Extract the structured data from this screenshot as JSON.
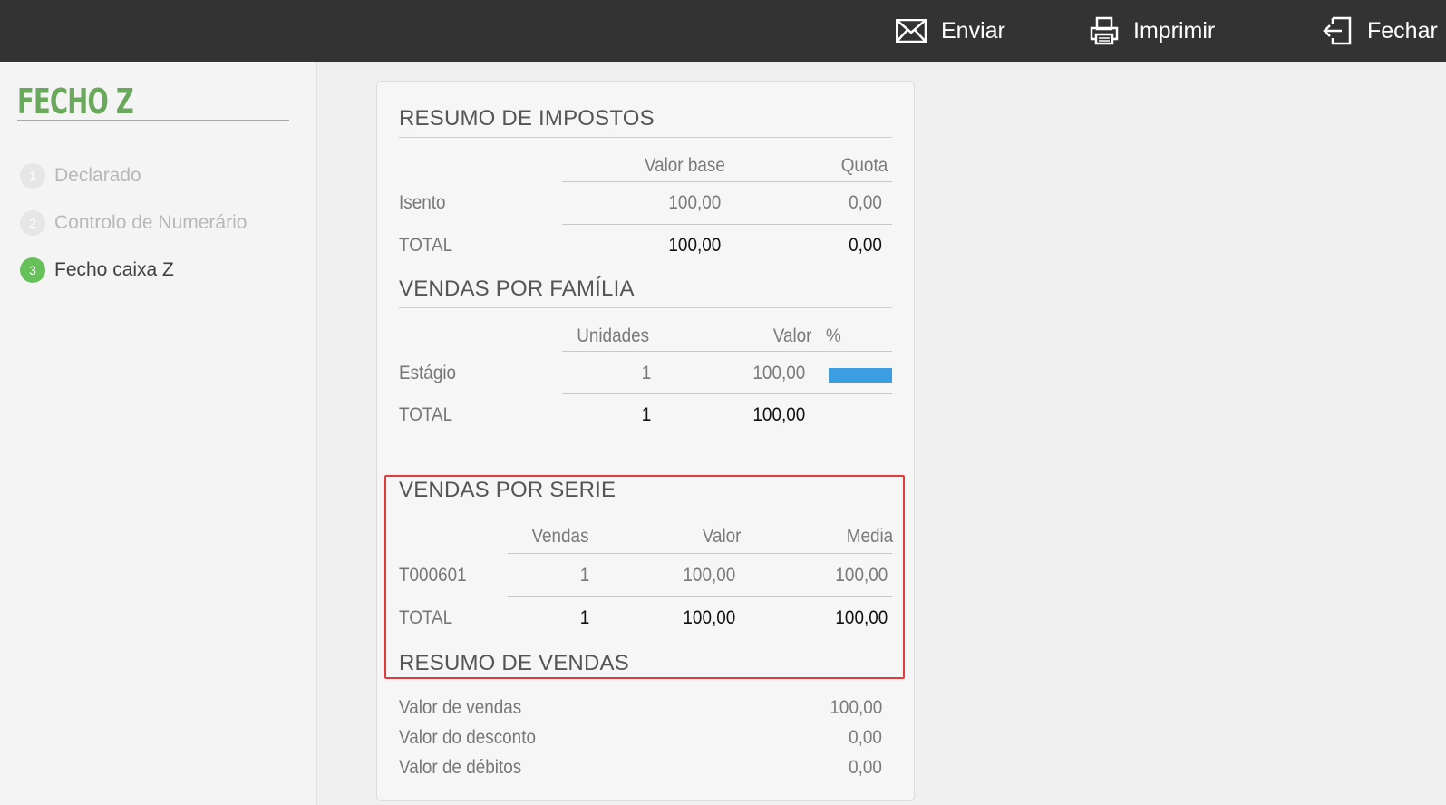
{
  "topbar": {
    "send_label": "Enviar",
    "print_label": "Imprimir",
    "close_label": "Fechar",
    "icons": [
      "envelope-icon",
      "printer-icon",
      "exit-icon"
    ]
  },
  "sidebar": {
    "title": "FECHO Z",
    "steps": [
      {
        "num": "1",
        "label": "Declarado",
        "active": false
      },
      {
        "num": "2",
        "label": "Controlo de Numerário",
        "active": false
      },
      {
        "num": "3",
        "label": "Fecho caixa Z",
        "active": true
      }
    ],
    "active_color": "#66c15a"
  },
  "taxes": {
    "title": "RESUMO DE IMPOSTOS",
    "headers": [
      "Valor base",
      "Quota"
    ],
    "rows": [
      {
        "label": "Isento",
        "base": "100,00",
        "quota": "0,00"
      }
    ],
    "total": {
      "label": "TOTAL",
      "base": "100,00",
      "quota": "0,00"
    }
  },
  "family": {
    "title": "VENDAS POR FAMÍLIA",
    "headers": [
      "Unidades",
      "Valor",
      "%"
    ],
    "rows": [
      {
        "label": "Estágio",
        "units": "1",
        "value": "100,00",
        "percent": 100
      }
    ],
    "total": {
      "label": "TOTAL",
      "units": "1",
      "value": "100,00"
    },
    "bar_color": "#3b9ee0"
  },
  "series": {
    "title": "VENDAS POR SERIE",
    "headers": [
      "Vendas",
      "Valor",
      "Media"
    ],
    "rows": [
      {
        "label": "T000601",
        "sales": "1",
        "value": "100,00",
        "avg": "100,00"
      }
    ],
    "total": {
      "label": "TOTAL",
      "sales": "1",
      "value": "100,00",
      "avg": "100,00"
    }
  },
  "summary": {
    "title": "RESUMO DE VENDAS",
    "rows": [
      {
        "label": "Valor de vendas",
        "value": "100,00"
      },
      {
        "label": "Valor do desconto",
        "value": "0,00"
      },
      {
        "label": "Valor de débitos",
        "value": "0,00"
      }
    ]
  },
  "highlight_color": "#e53a3a"
}
